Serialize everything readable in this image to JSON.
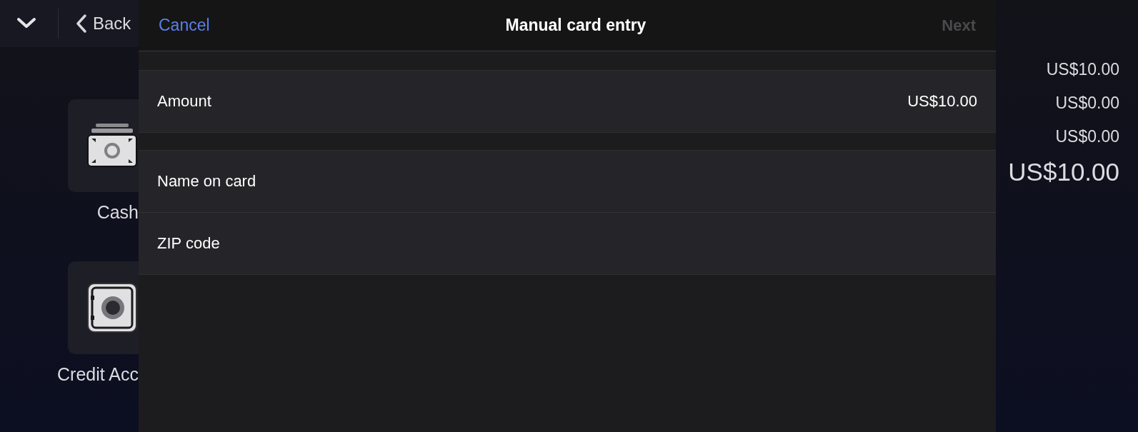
{
  "background": {
    "top_bar": {
      "back_label": "Back"
    },
    "tiles": [
      {
        "kind": "cash",
        "label": "Cash"
      },
      {
        "kind": "safe",
        "label": "Credit Acc"
      }
    ],
    "amounts": [
      "US$10.00",
      "US$0.00",
      "US$0.00"
    ],
    "total": "US$10.00"
  },
  "modal": {
    "title": "Manual card entry",
    "cancel": {
      "label": "Cancel"
    },
    "next": {
      "label": "Next",
      "disabled": true
    },
    "sections": [
      [
        {
          "kind": "value",
          "label": "Amount",
          "value": "US$10.00"
        }
      ],
      [
        {
          "kind": "input",
          "label": "Name on card"
        },
        {
          "kind": "input",
          "label": "ZIP code"
        }
      ]
    ]
  }
}
